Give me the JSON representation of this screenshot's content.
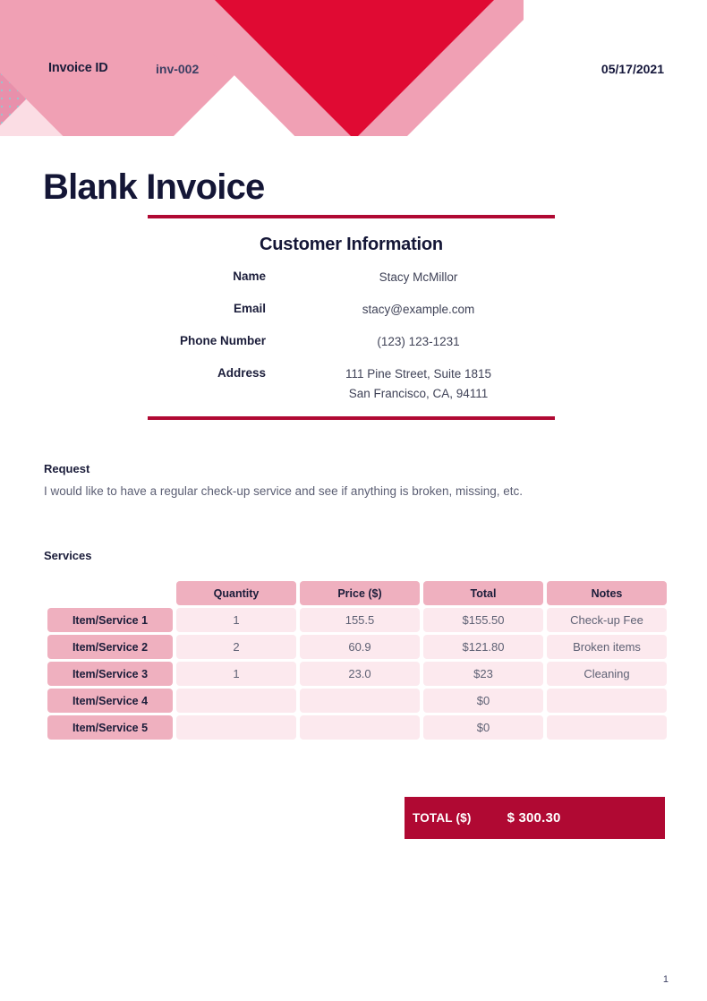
{
  "header": {
    "invoice_id_label": "Invoice ID",
    "invoice_id_value": "inv-002",
    "date": "05/17/2021",
    "colors": {
      "crimson": "#b00933",
      "bright_red": "#e00a33",
      "pink": "#f0a0b4",
      "pale_pink": "#fbdde4",
      "dark_navy": "#141636"
    }
  },
  "title": "Blank Invoice",
  "customer": {
    "heading": "Customer Information",
    "rows": [
      {
        "label": "Name",
        "value": "Stacy McMillor"
      },
      {
        "label": "Email",
        "value": "stacy@example.com"
      },
      {
        "label": "Phone Number",
        "value": "(123) 123-1231"
      }
    ],
    "address": {
      "label": "Address",
      "line1": "111 Pine Street, Suite 1815",
      "line2": "San Francisco, CA, 94111"
    }
  },
  "request": {
    "label": "Request",
    "text": "I would like to have a regular check-up service and see if anything is broken, missing, etc."
  },
  "services": {
    "label": "Services",
    "columns": [
      "Quantity",
      "Price ($)",
      "Total",
      "Notes"
    ],
    "rows": [
      {
        "label": "Item/Service 1",
        "quantity": "1",
        "price": "155.5",
        "total": "$155.50",
        "notes": "Check-up Fee"
      },
      {
        "label": "Item/Service 2",
        "quantity": "2",
        "price": "60.9",
        "total": "$121.80",
        "notes": "Broken items"
      },
      {
        "label": "Item/Service 3",
        "quantity": "1",
        "price": "23.0",
        "total": "$23",
        "notes": "Cleaning"
      },
      {
        "label": "Item/Service 4",
        "quantity": "",
        "price": "",
        "total": "$0",
        "notes": ""
      },
      {
        "label": "Item/Service 5",
        "quantity": "",
        "price": "",
        "total": "$0",
        "notes": ""
      }
    ]
  },
  "total": {
    "label": "TOTAL ($)",
    "value": "$ 300.30"
  },
  "page_number": "1"
}
